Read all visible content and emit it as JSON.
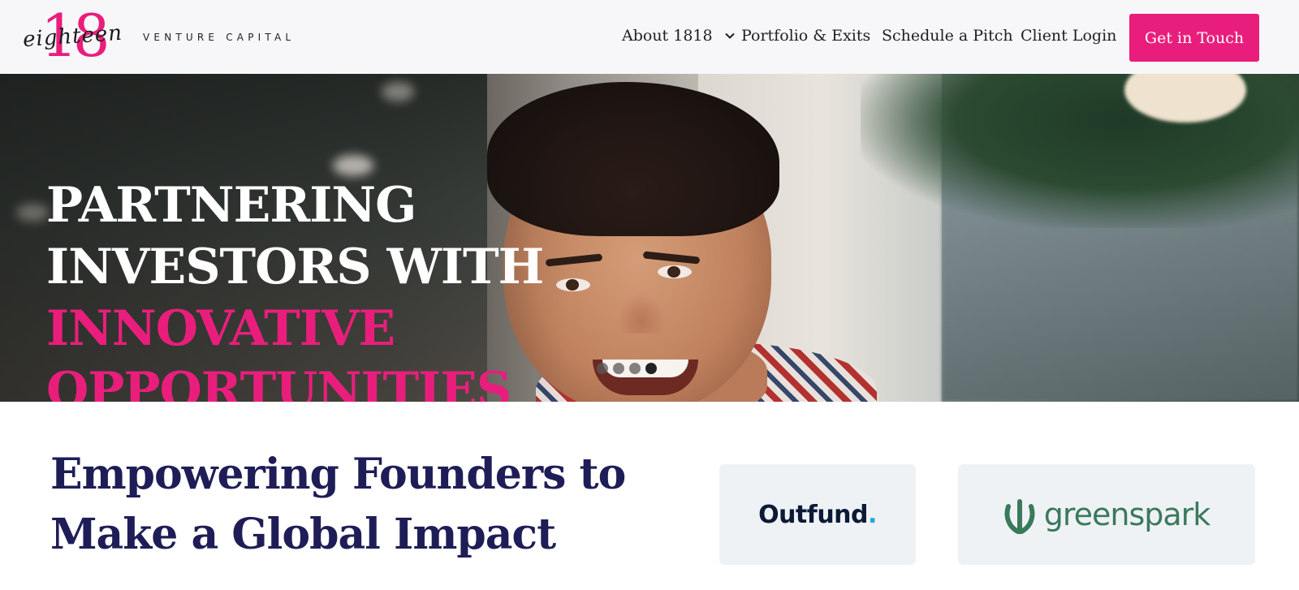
{
  "brand": {
    "logo_number": "18",
    "logo_script": "eighteen",
    "logo_tagline": "VENTURE CAPITAL",
    "accent_color": "#e91e7c",
    "navy_color": "#1f1d57"
  },
  "nav": {
    "about": "About 1818",
    "portfolio": "Portfolio & Exits",
    "pitch": "Schedule a Pitch",
    "login": "Client Login",
    "cta": "Get in Touch"
  },
  "hero": {
    "line1": "PARTNERING",
    "line2": "INVESTORS WITH",
    "line3": "INNOVATIVE",
    "line4": "OPPORTUNITIES",
    "slides": 4,
    "active_slide": 4
  },
  "section": {
    "title_line1": "Empowering Founders to",
    "title_line2": "Make a Global Impact"
  },
  "partners": {
    "outfund": "Outfund",
    "outfund_dot": ".",
    "greenspark": "greenspark"
  }
}
